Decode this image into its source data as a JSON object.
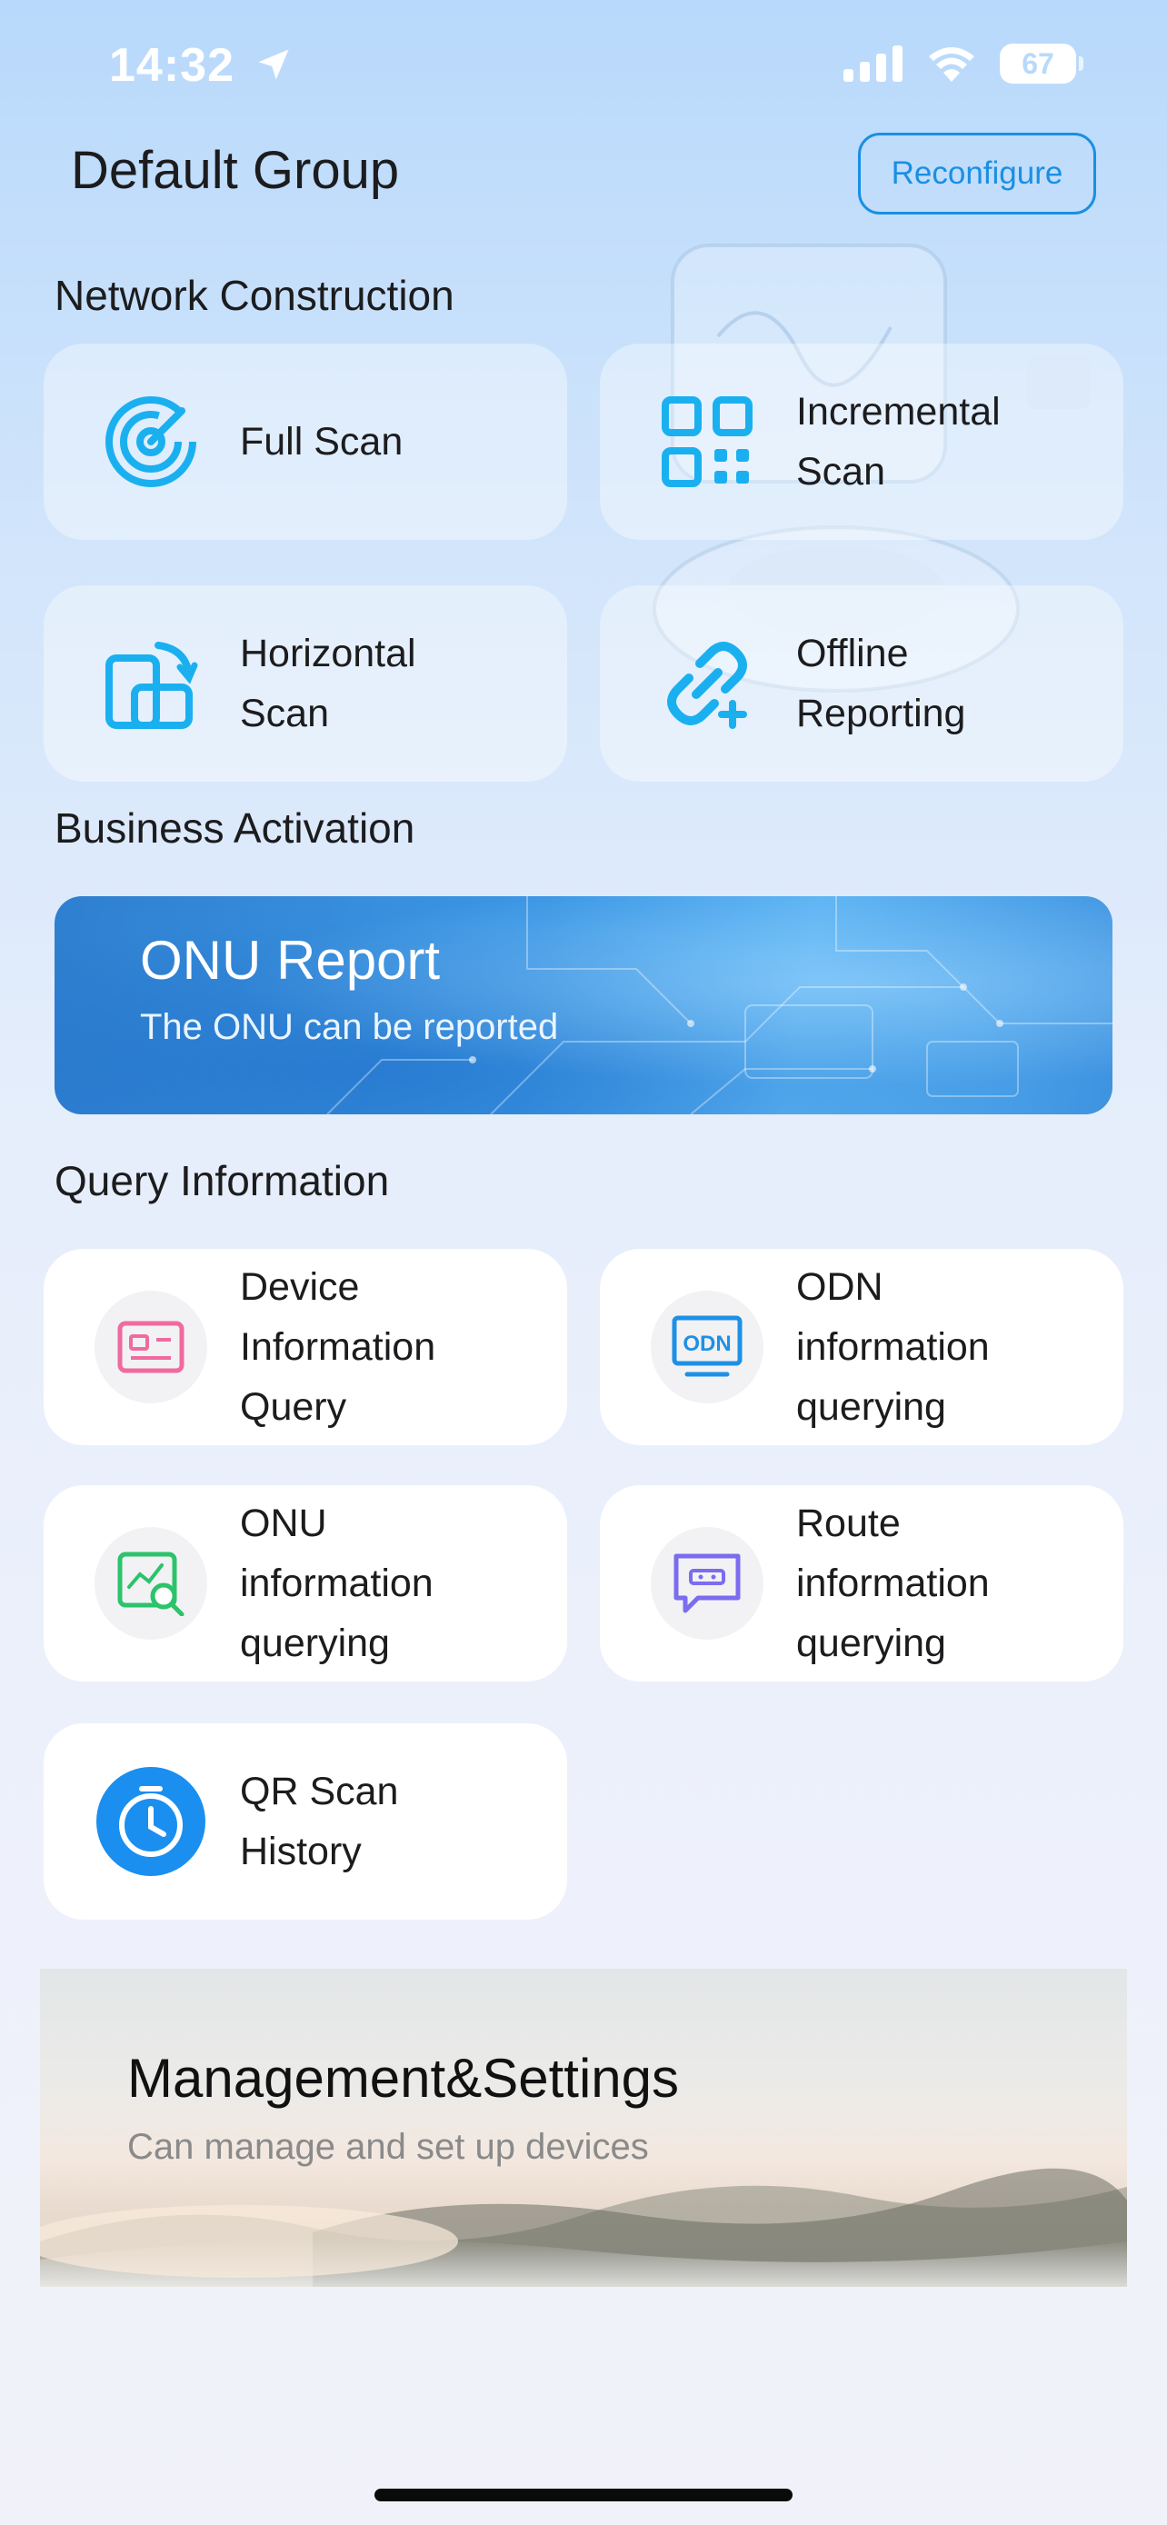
{
  "status_bar": {
    "time": "14:32",
    "battery": "67",
    "icons": [
      "location-arrow-icon",
      "signal-icon",
      "wifi-icon",
      "battery-icon"
    ]
  },
  "header": {
    "title": "Default Group",
    "reconfigure_label": "Reconfigure"
  },
  "sections": {
    "network_construction": "Network Construction",
    "business_activation": "Business Activation",
    "query_information": "Query Information"
  },
  "network_cards": [
    {
      "label": "Full Scan",
      "icon": "radar-icon"
    },
    {
      "label": "Incremental\nScan",
      "icon": "qr-code-icon"
    },
    {
      "label": "Horizontal\nScan",
      "icon": "rotate-device-icon"
    },
    {
      "label": "Offline\nReporting",
      "icon": "link-icon"
    }
  ],
  "onu_banner": {
    "title": "ONU Report",
    "subtitle": "The ONU can be reported"
  },
  "query_cards": [
    {
      "label": "Device\nInformation\nQuery",
      "icon": "id-card-icon"
    },
    {
      "label": "ODN\ninformation\nquerying",
      "icon": "odn-monitor-icon"
    },
    {
      "label": "ONU\ninformation\nquerying",
      "icon": "chart-search-icon"
    },
    {
      "label": "Route\ninformation\nquerying",
      "icon": "message-icon"
    },
    {
      "label": "QR Scan\nHistory",
      "icon": "clock-icon"
    }
  ],
  "management_banner": {
    "title": "Management&Settings",
    "subtitle": "Can manage and set up devices"
  },
  "colors": {
    "accent": "#1a8fe3",
    "network_icon": "#1ab0f0",
    "device_query_icon": "#f06aa0",
    "odn_icon": "#1e90e6",
    "onu_query_icon": "#2cc36b",
    "route_icon": "#7b6cf0",
    "history_icon_bg": "#1a8ff0"
  }
}
